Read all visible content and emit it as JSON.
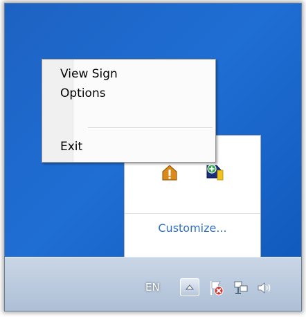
{
  "context_menu": {
    "items": [
      {
        "label": "View Sign"
      },
      {
        "label": "Options"
      },
      {
        "label": "Exit"
      }
    ]
  },
  "overflow_tray": {
    "customize_label": "Customize...",
    "icons": [
      "warning-shield-icon",
      "sign-plus-icon"
    ]
  },
  "taskbar": {
    "language": "EN",
    "tray_icons": [
      "show-hidden-icons-button",
      "action-center-flag-icon",
      "network-icon",
      "volume-icon"
    ]
  },
  "colors": {
    "desktop": "#1f6ed4",
    "link": "#2f6fc4",
    "taskbar": "#bccadd"
  }
}
